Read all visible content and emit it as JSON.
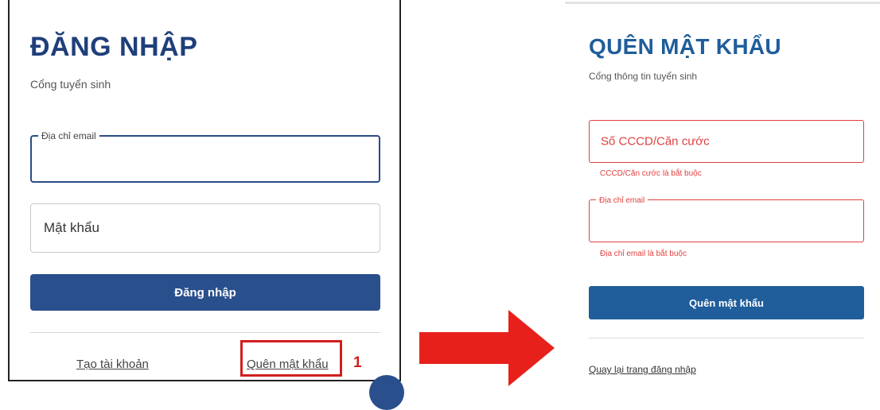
{
  "login": {
    "title": "ĐĂNG NHẬP",
    "subtitle": "Cổng tuyển sinh",
    "email_label": "Địa chỉ email",
    "password_placeholder": "Mật khẩu",
    "submit_label": "Đăng nhập",
    "create_account_link": "Tạo tài khoản",
    "forgot_password_link": "Quên mật khẩu",
    "step_number": "1"
  },
  "forgot": {
    "title": "QUÊN MẬT KHẨU",
    "subtitle": "Cổng thông tin tuyển sinh",
    "id_placeholder": "Số CCCD/Căn cước",
    "id_error": "CCCD/Căn cước là bắt buộc",
    "email_label": "Địa chỉ email",
    "email_error": "Địa chỉ email là bắt buộc",
    "submit_label": "Quên mật khẩu",
    "back_link": "Quay lại trang đăng nhập"
  },
  "colors": {
    "login_primary": "#2a4f8d",
    "forgot_primary": "#1f5d9b",
    "error": "#e04040",
    "highlight": "#d21f1f"
  },
  "icons": {
    "arrow": "right-arrow-icon"
  }
}
